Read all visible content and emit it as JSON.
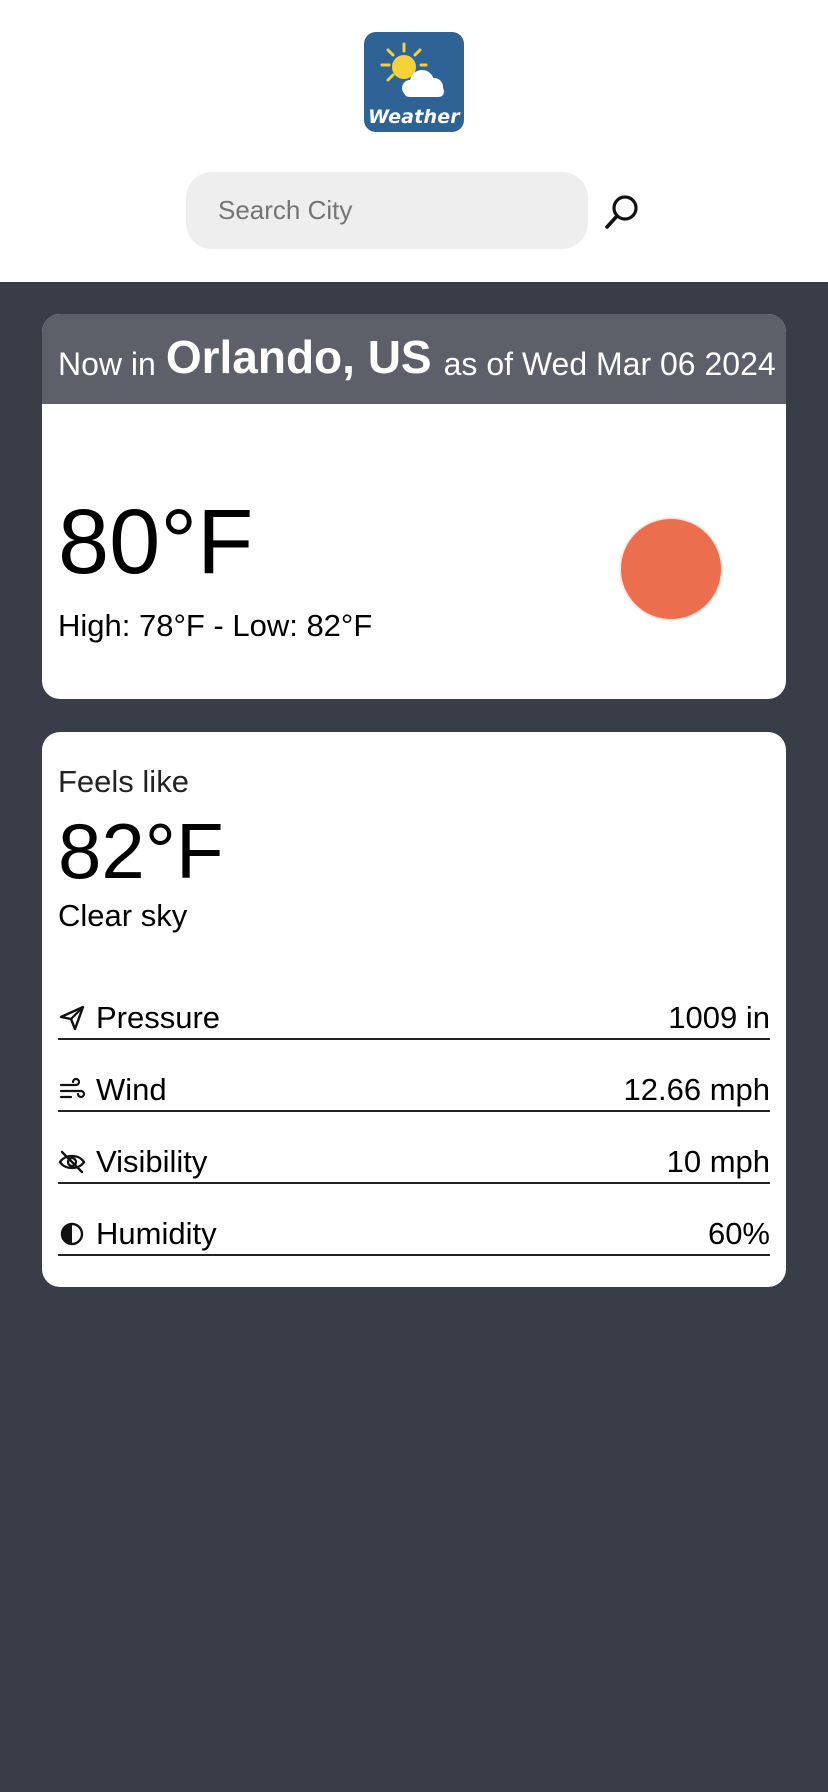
{
  "app": {
    "logo_text": "Weather"
  },
  "search": {
    "placeholder": "Search City",
    "value": "",
    "button_icon": "search-icon"
  },
  "current": {
    "prefix": "Now in",
    "city": "Orlando, US",
    "date_text": "as of Wed Mar 06 2024",
    "temperature": "80°F",
    "high_low": "High: 78°F - Low: 82°F",
    "condition_icon": "sun-icon",
    "icon_color": "#eb6f4f"
  },
  "details": {
    "feels_like_label": "Feels like",
    "feels_like_value": "82°F",
    "condition": "Clear sky",
    "metrics": [
      {
        "icon": "paper-plane-icon",
        "label": "Pressure",
        "value": "1009 in"
      },
      {
        "icon": "wind-icon",
        "label": "Wind",
        "value": "12.66 mph"
      },
      {
        "icon": "eye-off-icon",
        "label": "Visibility",
        "value": "10 mph"
      },
      {
        "icon": "half-drop-icon",
        "label": "Humidity",
        "value": "60%"
      }
    ]
  },
  "colors": {
    "page_background": "#393d47",
    "card_header": "#5e6069",
    "logo_background": "#2f6396",
    "sun": "#eb6f4f"
  }
}
